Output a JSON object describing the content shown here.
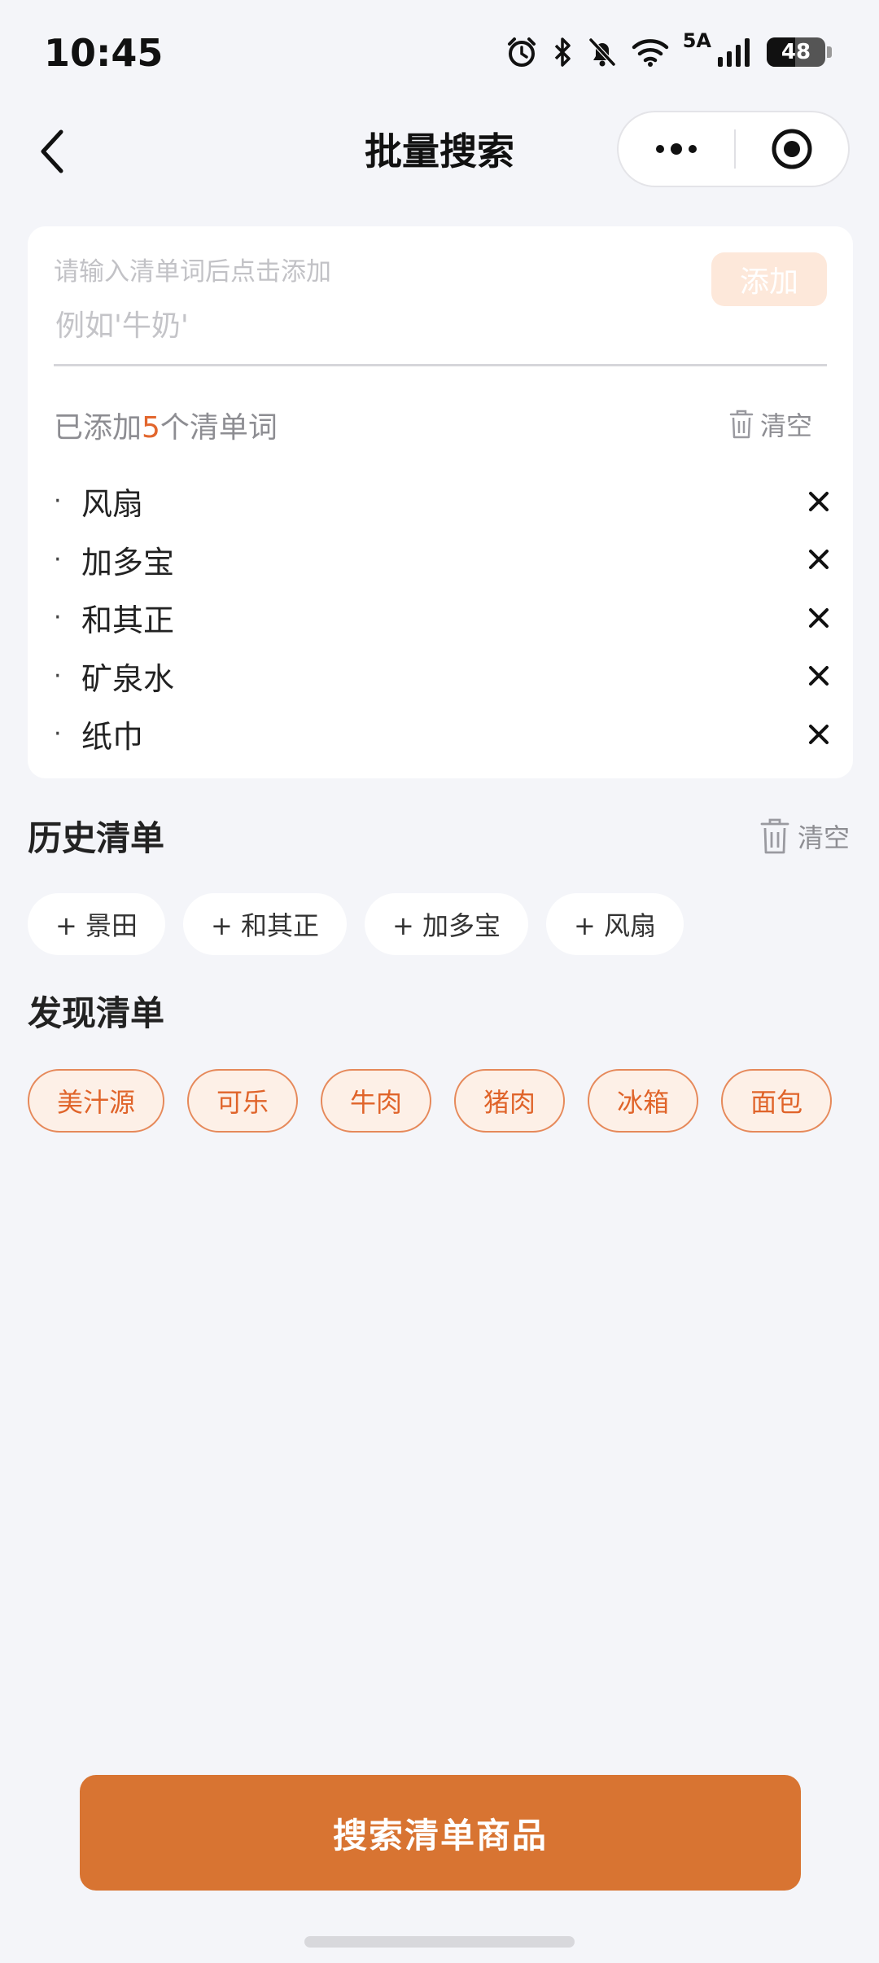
{
  "status_bar": {
    "time": "10:45",
    "network": "5A",
    "battery": "48"
  },
  "nav": {
    "title": "批量搜索"
  },
  "input_card": {
    "hint": "请输入清单词后点击添加",
    "placeholder": "例如'牛奶'",
    "add_label": "添加",
    "count_prefix": "已添加",
    "count_number": "5",
    "count_suffix": "个清单词",
    "clear_label": "清空",
    "bullet": "·",
    "words": [
      "风扇",
      "加多宝",
      "和其正",
      "矿泉水",
      "纸巾"
    ]
  },
  "history": {
    "title": "历史清单",
    "clear_label": "清空",
    "items": [
      "+ 景田",
      "+ 和其正",
      "+ 加多宝",
      "+ 风扇"
    ]
  },
  "discover": {
    "title": "发现清单",
    "items": [
      "美汁源",
      "可乐",
      "牛肉",
      "猪肉",
      "冰箱",
      "面包"
    ]
  },
  "search_button": {
    "label": "搜索清单商品"
  },
  "colors": {
    "accent": "#e2662d",
    "primary_button": "#d87432",
    "background": "#f4f5f9"
  }
}
